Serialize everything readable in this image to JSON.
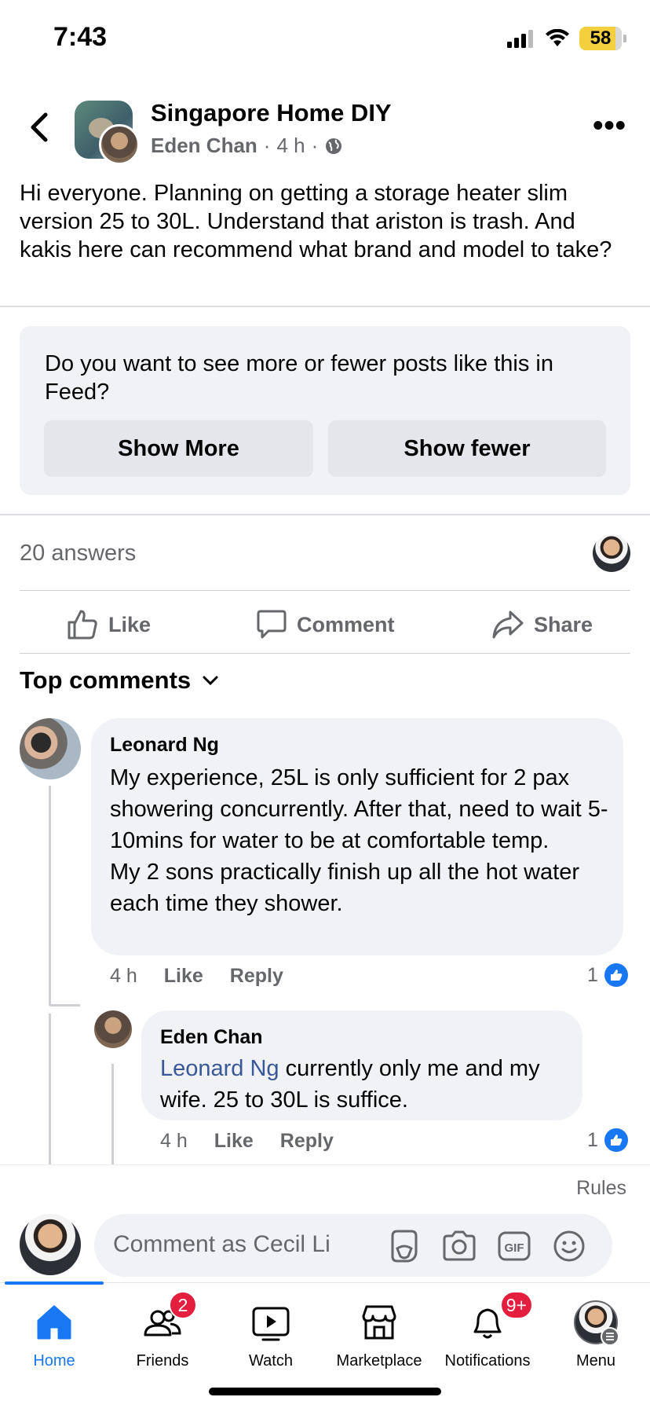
{
  "status_bar": {
    "time": "7:43",
    "battery": "58"
  },
  "post": {
    "group_name": "Singapore Home DIY",
    "author": "Eden Chan",
    "time": "4 h",
    "text": "Hi everyone. Planning on getting a storage heater slim version 25 to 30L. Understand that ariston is trash. And kakis here can recommend what brand and model to take?"
  },
  "feedback": {
    "question": "Do you want to see more or fewer posts like this in Feed?",
    "show_more": "Show More",
    "show_fewer": "Show fewer"
  },
  "summary": {
    "answers": "20 answers"
  },
  "actions": {
    "like": "Like",
    "comment": "Comment",
    "share": "Share"
  },
  "comments_section": {
    "title": "Top comments"
  },
  "comments": [
    {
      "name": "Leonard Ng",
      "text_line1": "My experience, 25L is only sufficient for 2 pax showering concurrently. After that, need to wait 5-10mins for water to be at comfortable temp.",
      "text_line2": "My 2 sons practically finish up all the hot water each time they shower.",
      "time": "4 h",
      "like": "Like",
      "reply": "Reply",
      "reactions": "1"
    },
    {
      "name": "Eden Chan",
      "mention": "Leonard Ng",
      "text": " currently only me and my wife. 25 to 30L is suffice.",
      "time": "4 h",
      "like": "Like",
      "reply": "Reply",
      "reactions": "1"
    }
  ],
  "composer": {
    "rules": "Rules",
    "placeholder": "Comment as Cecil Li"
  },
  "tabs": [
    {
      "label": "Home",
      "icon": "home-icon"
    },
    {
      "label": "Friends",
      "icon": "friends-icon",
      "badge": "2"
    },
    {
      "label": "Watch",
      "icon": "watch-icon"
    },
    {
      "label": "Marketplace",
      "icon": "marketplace-icon"
    },
    {
      "label": "Notifications",
      "icon": "bell-icon",
      "badge": "9+"
    },
    {
      "label": "Menu",
      "icon": "menu-avatar"
    }
  ],
  "colors": {
    "accent": "#1877f2",
    "badge": "#e41e3f",
    "mention": "#385898"
  }
}
